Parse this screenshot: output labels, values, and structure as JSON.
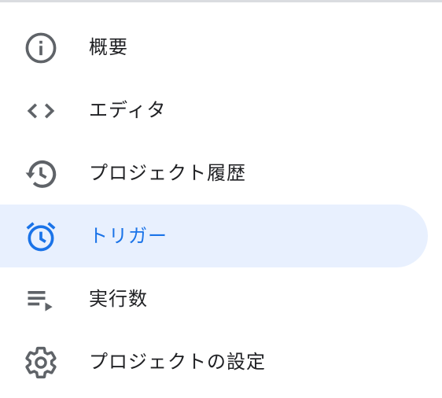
{
  "nav": {
    "items": [
      {
        "label": "概要",
        "icon": "info-icon",
        "active": false
      },
      {
        "label": "エディタ",
        "icon": "code-icon",
        "active": false
      },
      {
        "label": "プロジェクト履歴",
        "icon": "history-icon",
        "active": false
      },
      {
        "label": "トリガー",
        "icon": "alarm-icon",
        "active": true
      },
      {
        "label": "実行数",
        "icon": "playlist-play-icon",
        "active": false
      },
      {
        "label": "プロジェクトの設定",
        "icon": "gear-icon",
        "active": false
      }
    ]
  },
  "colors": {
    "icon": "#5f6368",
    "text": "#202124",
    "active_text": "#1a73e8",
    "active_background": "#e8f0fe",
    "divider": "#dadce0"
  }
}
